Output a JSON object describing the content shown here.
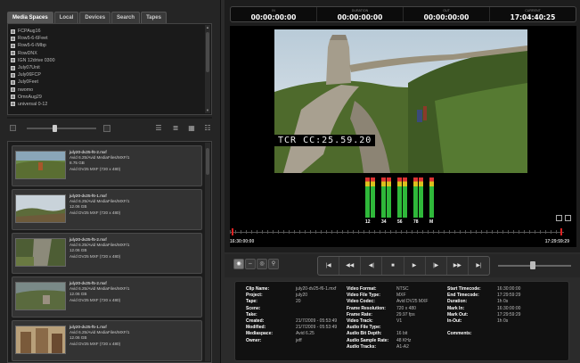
{
  "left_tabs": [
    "Media Spaces",
    "Local",
    "Devices",
    "Search",
    "Tapes"
  ],
  "folders": [
    "FCPAug16",
    "Row5-6-6Feet",
    "Row5-6-IMbp",
    "RowDNX",
    "IGN 12drive 0300",
    "July07Unit",
    "July06FCP",
    "July0Feet",
    "nwomo",
    "OmnAug29",
    "universal 0-12"
  ],
  "clips": [
    {
      "name": "july20-dv25-f6-2.mxf",
      "path": "Avid 6.25/Avid MediaFiles/MXF/1",
      "size": "8.75 GB",
      "format": "Avid DV25 MXF (720 x 480)"
    },
    {
      "name": "july20-dv25-f6-1.mxf",
      "path": "Avid 6.25/Avid MediaFiles/MXF/1",
      "size": "12.06 GB",
      "format": "Avid DV25 MXF (720 x 480)"
    },
    {
      "name": "july20-dv25-f5-2.mxf",
      "path": "Avid 6.25/Avid MediaFiles/MXF/1",
      "size": "12.06 GB",
      "format": "Avid DV25 MXF (720 x 480)"
    },
    {
      "name": "july20-dv25-f5-2.mxf",
      "path": "Avid 6.25/Avid MediaFiles/MXF/1",
      "size": "12.06 GB",
      "format": "Avid DV25 MXF (720 x 480)"
    },
    {
      "name": "july20-dv25-f5-1.mxf",
      "path": "Avid 6.25/Avid MediaFiles/MXF/1",
      "size": "12.06 GB",
      "format": "Avid DV25 MXF (720 x 480)"
    }
  ],
  "timecodes": [
    {
      "label": "IN",
      "value": "00:00:00:00"
    },
    {
      "label": "DURATION",
      "value": "00:00:00:00"
    },
    {
      "label": "OUT",
      "value": "00:00:00:00"
    },
    {
      "label": "CURRENT",
      "value": "17:04:40:25"
    }
  ],
  "burnin": "TCR CC:25.59.20",
  "meter_labels": [
    "12",
    "34",
    "56",
    "78",
    "M"
  ],
  "timeline": {
    "in": "16:30:00:00",
    "out": "17:29:59:29"
  },
  "transport": [
    "|◀",
    "◀◀",
    "◀|",
    "■",
    "▶",
    "|▶",
    "▶▶",
    "▶|"
  ],
  "tools": [
    "◉",
    "⇔",
    "◎",
    "⚲"
  ],
  "info": {
    "col1": [
      [
        "Clip Name:",
        "july20-dv25-f6-1.mxf"
      ],
      [
        "Project:",
        "july20"
      ],
      [
        "Tape:",
        "20"
      ],
      [
        "Scene:",
        ""
      ],
      [
        "Take:",
        ""
      ],
      [
        "Created:",
        "21/7/2009 - 05:53:49"
      ],
      [
        "Modified:",
        "21/7/2009 - 05:53:49"
      ],
      [
        "Mediaspace:",
        "Avid 6.25"
      ],
      [
        "Owner:",
        "jeff"
      ]
    ],
    "col2": [
      [
        "Video Format:",
        "NTSC"
      ],
      [
        "Video File Type:",
        "MXF"
      ],
      [
        "Video Codec:",
        "Avid DV25 MXF"
      ],
      [
        "Frame Resolution:",
        "720 x 480"
      ],
      [
        "Frame Rate:",
        "29.97 fps"
      ],
      [
        "Video Track:",
        "V1"
      ],
      [
        "Audio File Type:",
        ""
      ],
      [
        "Audio Bit Depth:",
        "16 bit"
      ],
      [
        "Audio Sample Rate:",
        "48 KHz"
      ],
      [
        "Audio Tracks:",
        "A1-A2"
      ]
    ],
    "col3": [
      [
        "Start Timecode:",
        "16:30:00:00"
      ],
      [
        "End Timecode:",
        "17:29:59:29"
      ],
      [
        "Duration:",
        "1h 0s"
      ],
      [
        "Mark In:",
        "16:30:00:00"
      ],
      [
        "Mark Out:",
        "17:29:59:29"
      ],
      [
        "In-Out:",
        "1h 0s"
      ],
      [
        "",
        ""
      ],
      [
        "Comments:",
        ""
      ]
    ]
  }
}
